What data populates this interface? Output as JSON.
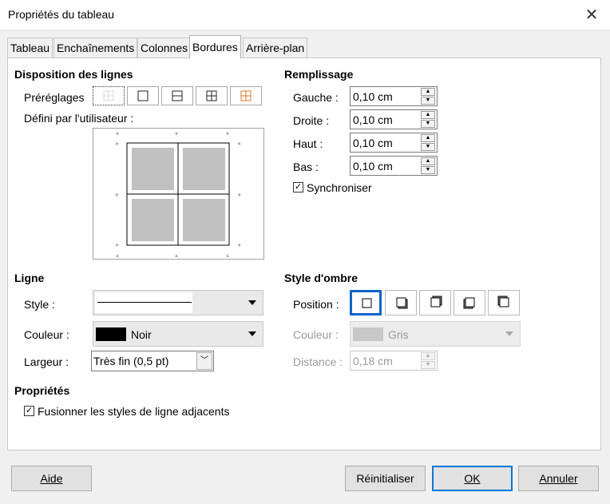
{
  "window": {
    "title": "Propriétés du tableau"
  },
  "tabs": [
    {
      "label": "Tableau"
    },
    {
      "label": "Enchaînements"
    },
    {
      "label": "Colonnes"
    },
    {
      "label": "Bordures",
      "active": true
    },
    {
      "label": "Arrière-plan"
    }
  ],
  "line_arrangement": {
    "heading": "Disposition des lignes",
    "presets_label": "Préréglages",
    "user_defined_label": "Défini par l'utilisateur :"
  },
  "padding": {
    "heading": "Remplissage",
    "left_label": "Gauche :",
    "left_value": "0,10 cm",
    "right_label": "Droite :",
    "right_value": "0,10 cm",
    "top_label": "Haut :",
    "top_value": "0,10 cm",
    "bottom_label": "Bas :",
    "bottom_value": "0,10 cm",
    "sync_label": "Synchroniser",
    "sync_checked": true
  },
  "line": {
    "heading": "Ligne",
    "style_label": "Style :",
    "color_label": "Couleur :",
    "color_value": "Noir",
    "color_swatch": "#000000",
    "width_label": "Largeur :",
    "width_value": "Très fin (0,5 pt)"
  },
  "shadow": {
    "heading": "Style d'ombre",
    "position_label": "Position :",
    "color_label": "Couleur :",
    "color_value": "Gris",
    "color_swatch": "#c0c0c0",
    "distance_label": "Distance :",
    "distance_value": "0,18 cm"
  },
  "properties": {
    "heading": "Propriétés",
    "merge_label": "Fusionner les styles de ligne adjacents",
    "merge_checked": true
  },
  "buttons": {
    "help": "Aide",
    "reset": "Réinitialiser",
    "ok": "OK",
    "cancel": "Annuler"
  },
  "colors": {
    "accent": "#0078d7",
    "cell_fill": "#c0c0c0",
    "orange_preset": "#e07020"
  }
}
